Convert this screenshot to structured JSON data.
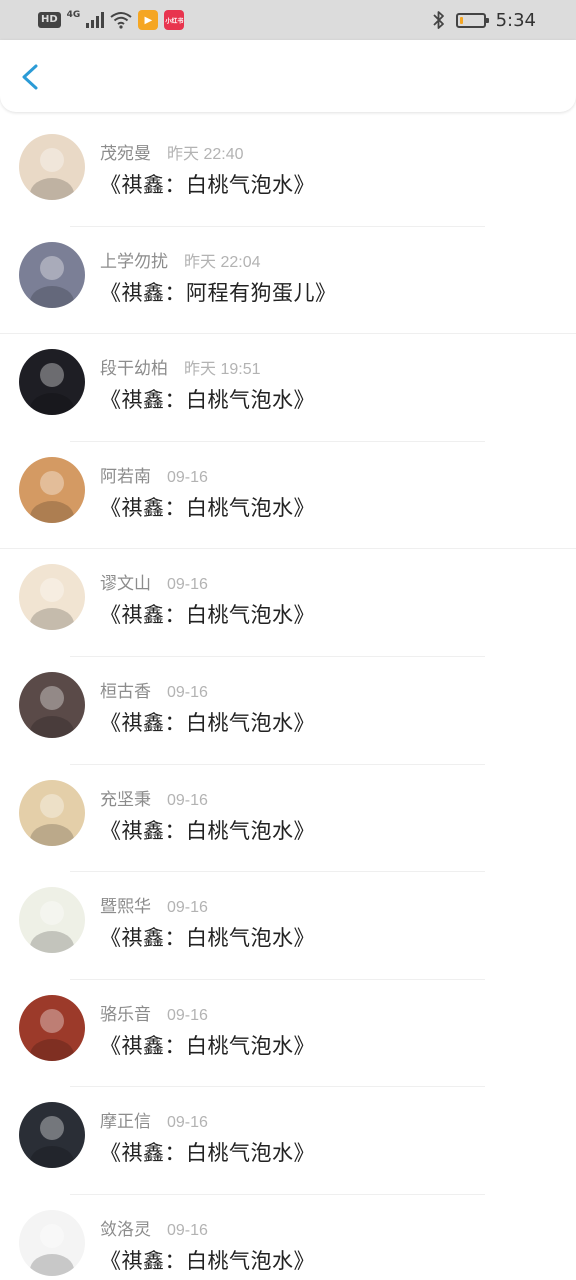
{
  "status_bar": {
    "hd": "HD",
    "network": "4G",
    "app_badge_1": "▶",
    "app_badge_2": "小红书",
    "time": "5:34",
    "battery_level": 0.15
  },
  "header": {
    "back_icon": "chevron-left-icon"
  },
  "comments": [
    {
      "username": "茂宛曼",
      "time": "昨天 22:40",
      "text": "《祺鑫：白桃气泡水》",
      "avatar_color": "#e9d9c6"
    },
    {
      "username": "上学勿扰",
      "time": "昨天 22:04",
      "text": "《祺鑫：阿程有狗蛋儿》",
      "avatar_color": "#7b7f96"
    },
    {
      "username": "段干幼柏",
      "time": "昨天 19:51",
      "text": "《祺鑫：白桃气泡水》",
      "avatar_color": "#1e1e24"
    },
    {
      "username": "阿若南",
      "time": "09-16",
      "text": "《祺鑫：白桃气泡水》",
      "avatar_color": "#d49a63"
    },
    {
      "username": "谬文山",
      "time": "09-16",
      "text": "《祺鑫：白桃气泡水》",
      "avatar_color": "#f1e4d2"
    },
    {
      "username": "桓古香",
      "time": "09-16",
      "text": "《祺鑫：白桃气泡水》",
      "avatar_color": "#5a4a48"
    },
    {
      "username": "充坚秉",
      "time": "09-16",
      "text": "《祺鑫：白桃气泡水》",
      "avatar_color": "#e4cfa9"
    },
    {
      "username": "暨熙华",
      "time": "09-16",
      "text": "《祺鑫：白桃气泡水》",
      "avatar_color": "#eef0e6"
    },
    {
      "username": "骆乐音",
      "time": "09-16",
      "text": "《祺鑫：白桃气泡水》",
      "avatar_color": "#9c3a2a"
    },
    {
      "username": "摩正信",
      "time": "09-16",
      "text": "《祺鑫：白桃气泡水》",
      "avatar_color": "#2a2e36"
    },
    {
      "username": "敛洛灵",
      "time": "09-16",
      "text": "《祺鑫：白桃气泡水》",
      "avatar_color": "#f4f4f4"
    }
  ]
}
